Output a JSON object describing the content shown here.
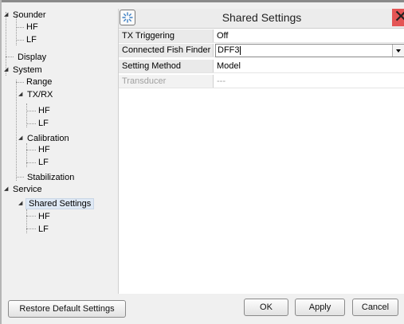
{
  "tree": {
    "sounder": "Sounder",
    "sounder_hf": "HF",
    "sounder_lf": "LF",
    "display": "Display",
    "system": "System",
    "range": "Range",
    "txrx": "TX/RX",
    "txrx_hf": "HF",
    "txrx_lf": "LF",
    "calibration": "Calibration",
    "calibration_hf": "HF",
    "calibration_lf": "LF",
    "stabilization": "Stabilization",
    "service": "Service",
    "shared_settings": "Shared Settings",
    "shared_hf": "HF",
    "shared_lf": "LF"
  },
  "panel": {
    "title": "Shared Settings",
    "icon": "settings-sparkle-icon",
    "close_icon": "close-icon",
    "rows": [
      {
        "name": "TX Triggering",
        "value": "Off"
      },
      {
        "name": "Connected Fish Finder",
        "value": "DFF3"
      },
      {
        "name": "Setting Method",
        "value": "Model"
      },
      {
        "name": "Transducer",
        "value": "---"
      }
    ]
  },
  "buttons": {
    "restore": "Restore Default Settings",
    "ok": "OK",
    "apply": "Apply",
    "cancel": "Cancel"
  },
  "colors": {
    "close": "#e45555",
    "selection": "#dfe9f5"
  }
}
